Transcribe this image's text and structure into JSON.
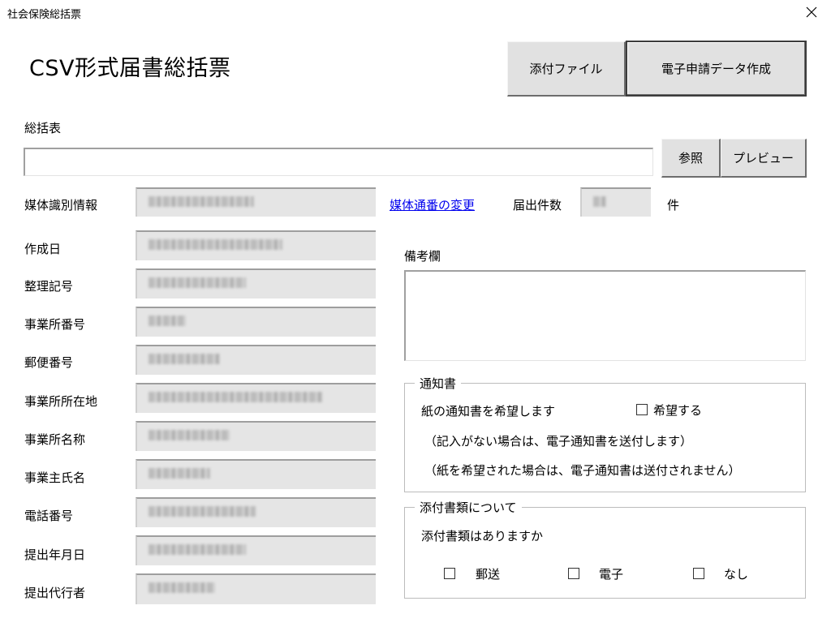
{
  "window": {
    "title": "社会保険総括票"
  },
  "heading": "CSV形式届書総括票",
  "toolbar": {
    "attach_label": "添付ファイル",
    "create_label": "電子申請データ作成"
  },
  "summary": {
    "label": "総括表",
    "path_value": "",
    "browse_label": "参照",
    "preview_label": "プレビュー"
  },
  "media": {
    "label": "媒体識別情報",
    "change_link": "媒体通番の変更",
    "count_label": "届出件数",
    "count_unit": "件"
  },
  "fields": [
    {
      "label": "作成日"
    },
    {
      "label": "整理記号"
    },
    {
      "label": "事業所番号"
    },
    {
      "label": "郵便番号"
    },
    {
      "label": "事業所所在地"
    },
    {
      "label": "事業所名称"
    },
    {
      "label": "事業主氏名"
    },
    {
      "label": "電話番号"
    },
    {
      "label": "提出年月日"
    },
    {
      "label": "提出代行者"
    }
  ],
  "remarks": {
    "label": "備考欄",
    "value": ""
  },
  "notice": {
    "group_title": "通知書",
    "question": "紙の通知書を希望します",
    "checkbox_label": "希望する",
    "checked": false,
    "note1": "（記入がない場合は、電子通知書を送付します）",
    "note2": "（紙を希望された場合は、電子通知書は送付されません）"
  },
  "attachments": {
    "group_title": "添付書類について",
    "question": "添付書類はありますか",
    "options": [
      {
        "label": "郵送",
        "checked": false
      },
      {
        "label": "電子",
        "checked": false
      },
      {
        "label": "なし",
        "checked": false
      }
    ]
  }
}
